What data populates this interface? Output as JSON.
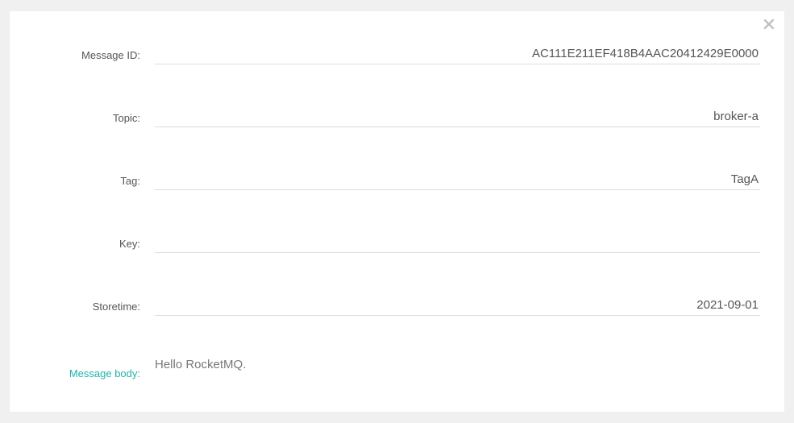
{
  "form": {
    "message_id": {
      "label": "Message ID:",
      "value": "AC111E211EF418B4AAC20412429E0000"
    },
    "topic": {
      "label": "Topic:",
      "value": "broker-a"
    },
    "tag": {
      "label": "Tag:",
      "value": "TagA"
    },
    "key": {
      "label": "Key:",
      "value": ""
    },
    "storetime": {
      "label": "Storetime:",
      "value": "2021-09-01"
    },
    "message_body": {
      "label": "Message body:",
      "value": "Hello RocketMQ."
    }
  }
}
